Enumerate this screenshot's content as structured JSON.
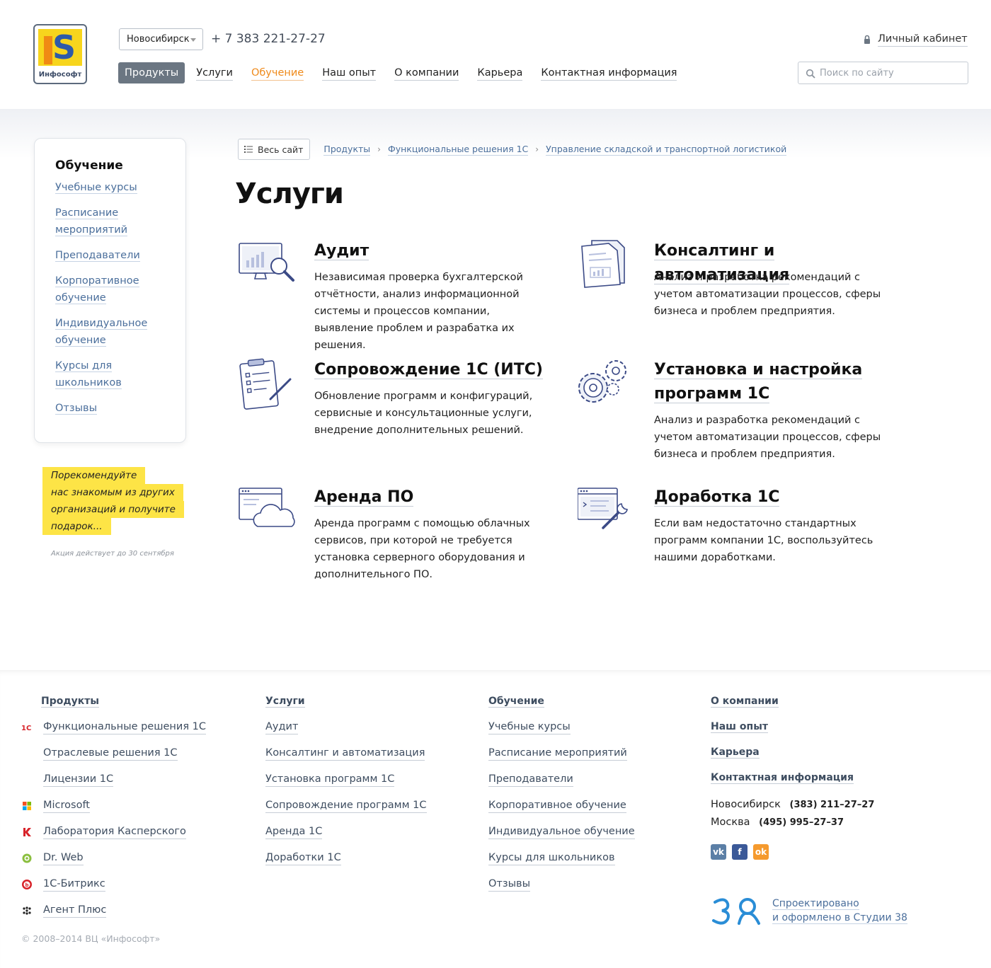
{
  "header": {
    "logo_text": "Инфософт",
    "city": "Новосибирск",
    "phone": "+ 7 383 221-27-27",
    "cabinet": "Личный кабинет",
    "search_placeholder": "Поиск по сайту",
    "nav": [
      "Продукты",
      "Услуги",
      "Обучение",
      "Наш опыт",
      "О компании",
      "Карьера",
      "Контактная информация"
    ]
  },
  "sidebar": {
    "title": "Обучение",
    "links": [
      "Учебные курсы",
      "Расписание мероприятий",
      "Преподаватели",
      "Корпоративное обучение",
      "Индивидуальное обучение",
      "Курсы для школьников",
      "Отзывы"
    ]
  },
  "promo": {
    "lines": [
      "Порекомендуйте",
      "нас знакомым из других",
      "организаций и получите",
      "подарок..."
    ],
    "note": "Акция действует до 30 сентября"
  },
  "breadcrumbs": {
    "all_site": "Весь сайт",
    "items": [
      "Продукты",
      "Функциональные решения 1С",
      "Управление складской и транспортной логистикой"
    ]
  },
  "page_title": "Услуги",
  "services": [
    {
      "title": "Аудит",
      "desc": "Независимая проверка бухгалтерской отчётности, анализ информационной системы и процессов компании, выявление проблем и разрабатка их решения.",
      "icon": "audit-icon"
    },
    {
      "title": "Консалтинг и автоматизация",
      "desc": "Анализ и разработка рекомендаций с учетом автоматизации процессов, сферы бизнеса и проблем предприятия.",
      "icon": "documents-icon"
    },
    {
      "title": "Сопровождение 1С (ИТС)",
      "desc": "Обновление программ и конфигураций, сервисные и консультационные услуги, внедрение дополнительных решений.",
      "icon": "clipboard-icon"
    },
    {
      "title": "Установка и настройка программ 1С",
      "desc": "Анализ и разработка рекомендаций с учетом автоматизации процессов, сферы бизнеса и проблем предприятия.",
      "icon": "gears-icon"
    },
    {
      "title": "Аренда ПО",
      "desc": "Аренда программ с помощью облачных сервисов, при которой не требуется установка серверного оборудования и дополнительного ПО.",
      "icon": "cloud-icon"
    },
    {
      "title": "Доработка 1С",
      "desc": "Если вам недостаточно стандартных программ компании 1С, воспользуйтесь нашими доработками.",
      "icon": "wrench-window-icon"
    }
  ],
  "footer": {
    "products": {
      "head": "Продукты",
      "items": [
        {
          "label": "Функциональные решения 1С",
          "icon": "1c-icon"
        },
        {
          "label": "Отраслевые решения 1С",
          "icon": ""
        },
        {
          "label": "Лицензии 1С",
          "icon": ""
        },
        {
          "label": "Microsoft",
          "icon": "microsoft-icon"
        },
        {
          "label": "Лаборатория Касперского",
          "icon": "kaspersky-icon"
        },
        {
          "label": "Dr. Web",
          "icon": "drweb-icon"
        },
        {
          "label": "1С-Битрикс",
          "icon": "bitrix-icon"
        },
        {
          "label": "Агент Плюс",
          "icon": "agentplus-icon"
        }
      ]
    },
    "services": {
      "head": "Услуги",
      "items": [
        "Аудит",
        "Консалтинг и автоматизация",
        "Установка программ 1С",
        "Сопровождение программ 1С",
        "Аренда 1С",
        "Доработки 1С"
      ]
    },
    "education": {
      "head": "Обучение",
      "items": [
        "Учебные курсы",
        "Расписание мероприятий",
        "Преподаватели",
        "Корпоративное обучение",
        "Индивидуальное обучение",
        "Курсы для школьников",
        "Отзывы"
      ]
    },
    "company": {
      "heads": [
        "О компании",
        "Наш опыт",
        "Карьера",
        "Контактная информация"
      ],
      "contacts": [
        {
          "city": "Новосибирск",
          "phone": "(383) 211–27–27"
        },
        {
          "city": "Москва",
          "phone": "(495) 995–27–37"
        }
      ],
      "socials": [
        "vk-icon",
        "facebook-icon",
        "odnoklassniki-icon"
      ]
    },
    "studio": {
      "line1": "Спроектировано",
      "line2": "и оформлено в Студии 38"
    },
    "copyright": "© 2008–2014 ВЦ «Инфософт»"
  },
  "colors": {
    "accent": "#ef8a1b",
    "link": "#4b6f9c",
    "nav_active_bg": "#6b7682",
    "promo_bg": "#fde446",
    "icon_stroke": "#3b4a86"
  }
}
